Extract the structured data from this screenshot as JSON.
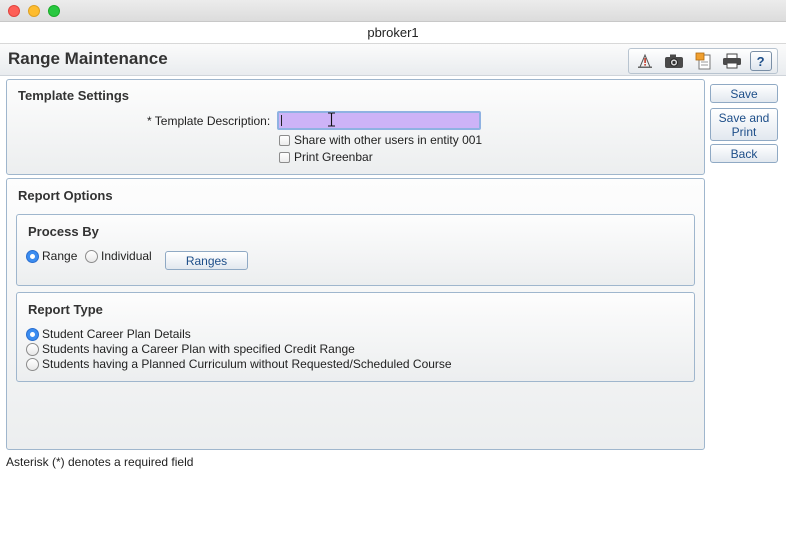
{
  "window": {
    "title": "pbroker1"
  },
  "header": {
    "title": "Range Maintenance",
    "toolbar": [
      {
        "icon": "alert-icon"
      },
      {
        "icon": "camera-icon"
      },
      {
        "icon": "notes-icon"
      },
      {
        "icon": "printer-icon"
      },
      {
        "icon": "help-icon",
        "label": "?"
      }
    ]
  },
  "template_settings": {
    "title": "Template Settings",
    "description_label": "* Template Description:",
    "description_value": "",
    "share_label": "Share with other users in entity 001",
    "share_checked": false,
    "greenbar_label": "Print Greenbar",
    "greenbar_checked": false
  },
  "report_options": {
    "title": "Report Options",
    "process_by": {
      "title": "Process By",
      "options": [
        {
          "label": "Range",
          "selected": true
        },
        {
          "label": "Individual",
          "selected": false
        }
      ],
      "ranges_button": "Ranges"
    },
    "report_type": {
      "title": "Report Type",
      "options": [
        {
          "label": "Student Career Plan Details",
          "selected": true
        },
        {
          "label": "Students having a Career Plan with specified Credit Range",
          "selected": false
        },
        {
          "label": "Students having a Planned Curriculum without Requested/Scheduled Course",
          "selected": false
        }
      ]
    }
  },
  "actions": {
    "save": "Save",
    "save_print": "Save and Print",
    "back": "Back"
  },
  "footer": {
    "note": "Asterisk (*) denotes a required field"
  },
  "colors": {
    "accent": "#1d4e89",
    "input_highlight": "#cdb3f7",
    "radio_selected": "#3b8cf0"
  }
}
